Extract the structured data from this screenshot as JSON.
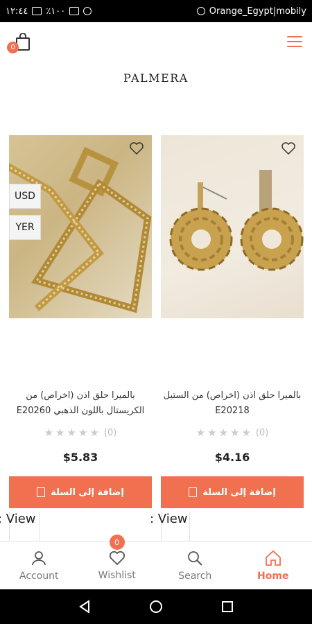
{
  "status_bar": {
    "time": "١٢:٤٤",
    "battery": "٪١٠٠",
    "carrier": "Orange_Egypt|mobily"
  },
  "header": {
    "cart_count": "0",
    "logo": "PALMERA"
  },
  "currency_options": [
    "USD",
    "YER"
  ],
  "products": [
    {
      "title": "بالميرا حلق اذن (اخراص) من الكريستال باللون الذهبي E20260",
      "rating_count": "(0)",
      "price": "$5.83",
      "add_to_cart": "إضافة إلى السلة",
      "view_label": ": View"
    },
    {
      "title": "بالميرا حلق اذن (اخراص) من الستيل E20218",
      "rating_count": "(0)",
      "price": "$4.16",
      "add_to_cart": "إضافة إلى السلة",
      "view_label": ": View"
    }
  ],
  "bottom_nav": {
    "items": [
      {
        "label": "Account",
        "icon": "user-icon"
      },
      {
        "label": "Wishlist",
        "icon": "heart-icon",
        "badge": "0"
      },
      {
        "label": "Search",
        "icon": "search-icon"
      },
      {
        "label": "Home",
        "icon": "home-icon",
        "active": true
      }
    ]
  },
  "colors": {
    "accent": "#f07050"
  }
}
